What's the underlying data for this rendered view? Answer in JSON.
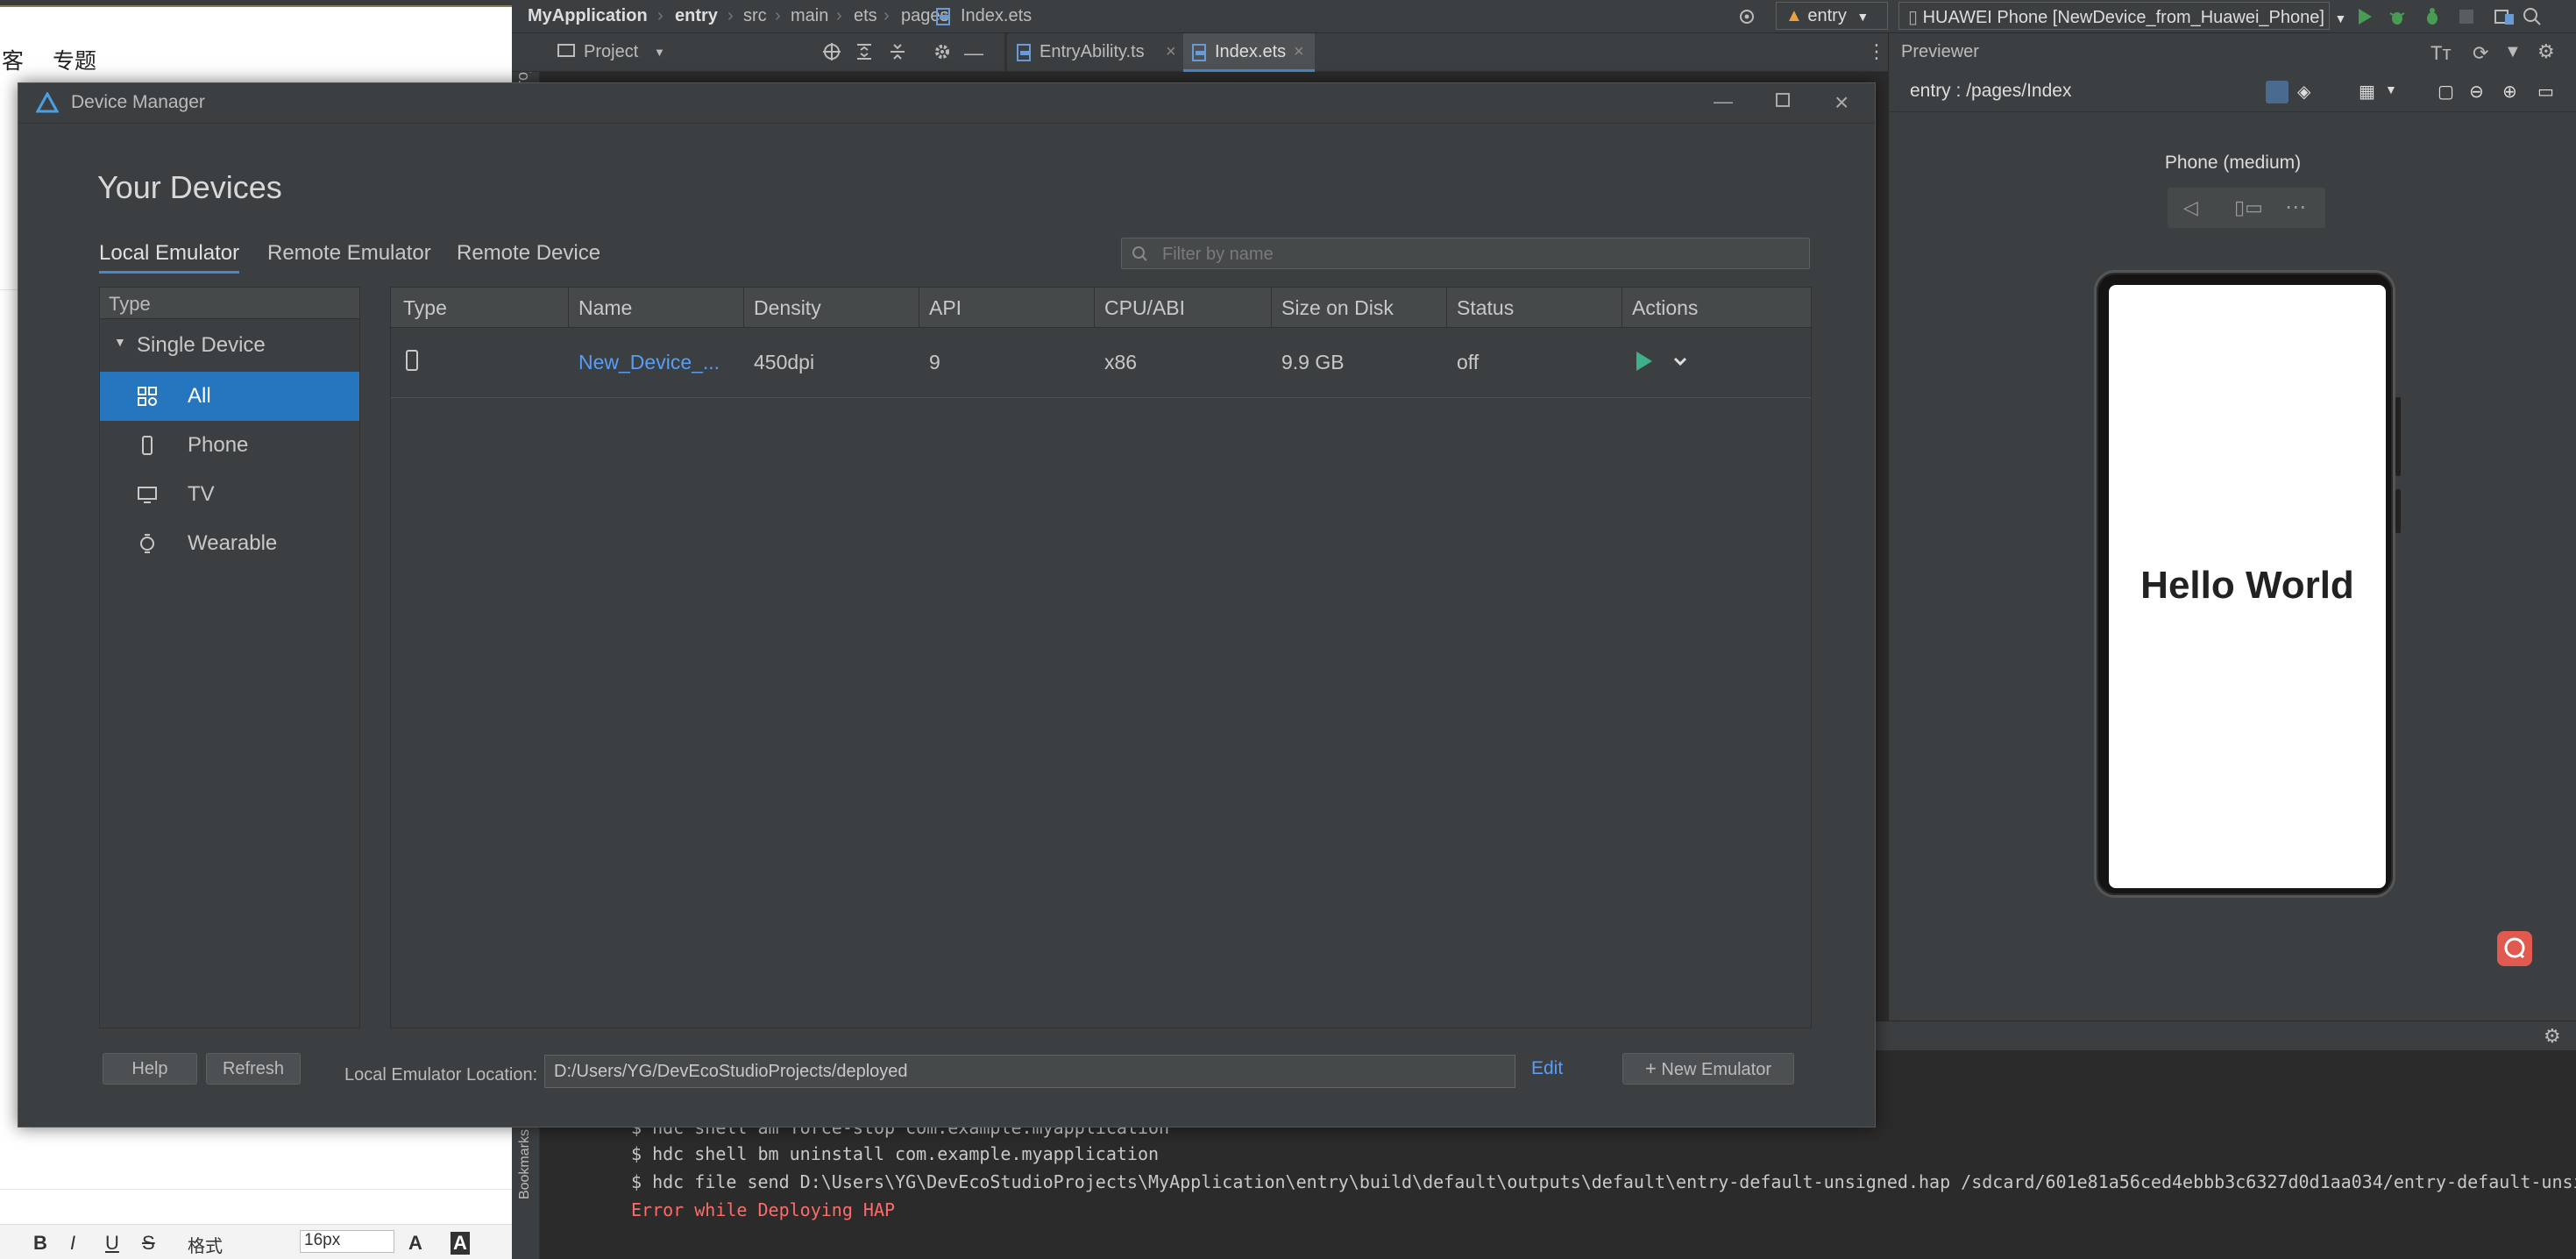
{
  "browser": {
    "nav": [
      "客",
      "专题"
    ],
    "editor_toolbar": {
      "bold": "B",
      "italic": "I",
      "underline": "U",
      "strike": "S",
      "format": "格式",
      "font_size": "16px",
      "font_color": "A",
      "bg_color": "A"
    }
  },
  "ide": {
    "breadcrumb": [
      "MyApplication",
      "entry",
      "src",
      "main",
      "ets",
      "pages",
      "Index.ets"
    ],
    "module_select": "entry",
    "device_select": "HUAWEI Phone [NewDevice_from_Huawei_Phone]",
    "project_label": "Project",
    "side_label": "Project",
    "tabs": [
      {
        "label": "EntryAbility.ts"
      },
      {
        "label": "Index.ets"
      }
    ],
    "previewer": {
      "title": "Previewer",
      "path": "entry : /pages/Index",
      "device_name": "Phone (medium)",
      "screen_text": "Hello World"
    },
    "console": {
      "lines": [
        "$ hdc shell am force-stop com.example.myapplication",
        "$ hdc shell bm uninstall com.example.myapplication",
        "$ hdc file send D:\\Users\\YG\\DevEcoStudioProjects\\MyApplication\\entry\\build\\default\\outputs\\default\\entry-default-unsigned.hap /sdcard/601e81a56ced4ebbb3c6327d0d1aa034/entry-default-unsi"
      ],
      "error": "Error while Deploying HAP",
      "bookmarks_label": "Bookmarks"
    }
  },
  "device_manager": {
    "window_title": "Device Manager",
    "heading": "Your Devices",
    "tabs": [
      "Local Emulator",
      "Remote Emulator",
      "Remote Device"
    ],
    "filter_placeholder": "Filter by name",
    "type_panel": {
      "header": "Type",
      "group": "Single Device",
      "items": [
        {
          "label": "All",
          "icon": "grid-icon",
          "selected": true
        },
        {
          "label": "Phone",
          "icon": "phone-icon"
        },
        {
          "label": "TV",
          "icon": "tv-icon"
        },
        {
          "label": "Wearable",
          "icon": "watch-icon"
        }
      ]
    },
    "table": {
      "columns": [
        "Type",
        "Name",
        "Density",
        "API",
        "CPU/ABI",
        "Size on Disk",
        "Status",
        "Actions"
      ],
      "rows": [
        {
          "type_icon": "phone-icon",
          "name": "New_Device_...",
          "density": "450dpi",
          "api": "9",
          "cpu": "x86",
          "size": "9.9 GB",
          "status": "off"
        }
      ]
    },
    "footer": {
      "help": "Help",
      "refresh": "Refresh",
      "location_label": "Local Emulator Location:",
      "location_value": "D:/Users/YG/DevEcoStudioProjects/deployed",
      "edit": "Edit",
      "new_emulator": "New Emulator"
    }
  },
  "colors": {
    "accent": "#2675bf",
    "link": "#589df6",
    "run_green": "#499c54",
    "error": "#ff6b68",
    "dialog_bg": "#3c3f41"
  }
}
